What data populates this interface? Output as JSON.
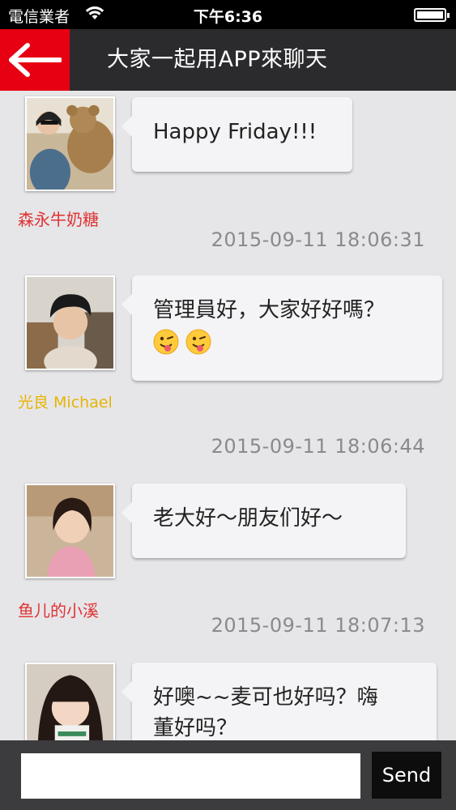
{
  "status_bar": {
    "carrier": "電信業者",
    "time": "下午6:36"
  },
  "nav": {
    "back_icon": "arrow-left-icon",
    "title": "大家一起用APP來聊天"
  },
  "colors": {
    "brand_red": "#e60012",
    "nav_background": "#2b2b2e",
    "name_red": "#e03232",
    "name_gold": "#e8b400"
  },
  "messages": [
    {
      "sender": "森永牛奶糖",
      "sender_color": "#e03232",
      "text": "Happy Friday!!!",
      "text_line2": "",
      "timestamp": "2015-09-11 18:06:31"
    },
    {
      "sender": "光良 Michael",
      "sender_color": "#e8b400",
      "text": "管理員好，大家好好嗎？",
      "emojis": [
        "tongue-wink-emoji",
        "tongue-wink-emoji"
      ],
      "timestamp": "2015-09-11 18:06:44"
    },
    {
      "sender": "鱼儿的小溪",
      "sender_color": "#e03232",
      "text": "老大好～朋友们好～",
      "timestamp": "2015-09-11 18:07:13"
    },
    {
      "sender": "",
      "text": "好噢~~麦可也好吗？嗨",
      "text_line2": "董好吗？"
    }
  ],
  "composer": {
    "placeholder": "",
    "value": "",
    "send_label": "Send"
  }
}
